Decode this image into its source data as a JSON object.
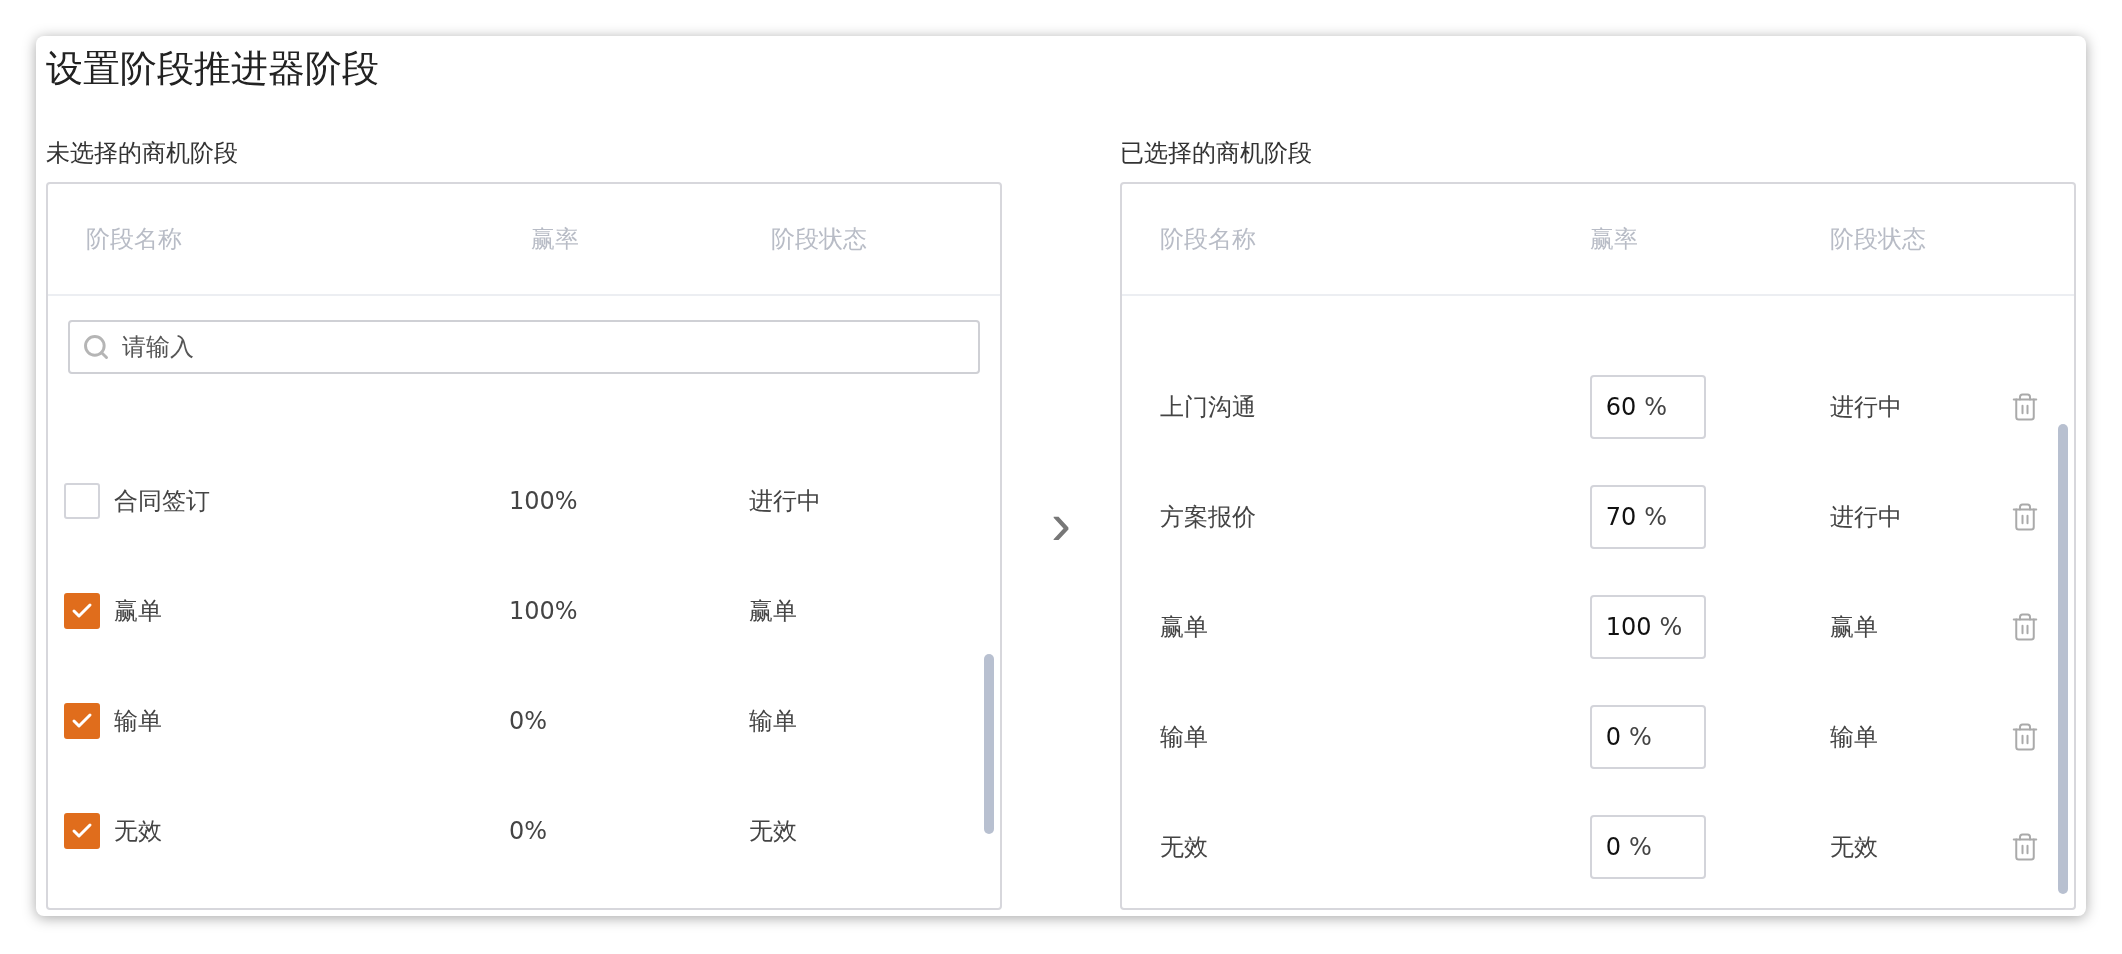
{
  "dialog": {
    "title": "设置阶段推进器阶段"
  },
  "unselected": {
    "title": "未选择的商机阶段",
    "columns": [
      "阶段名称",
      "赢率",
      "阶段状态"
    ],
    "search": {
      "placeholder": "请输入"
    },
    "rows": [
      {
        "name": "合同签订",
        "rate": "100%",
        "status": "进行中",
        "checked": false
      },
      {
        "name": "赢单",
        "rate": "100%",
        "status": "赢单",
        "checked": true
      },
      {
        "name": "输单",
        "rate": "0%",
        "status": "输单",
        "checked": true
      },
      {
        "name": "无效",
        "rate": "0%",
        "status": "无效",
        "checked": true
      }
    ]
  },
  "move_button": {
    "label": "›"
  },
  "selected": {
    "title": "已选择的商机阶段",
    "columns": [
      "阶段名称",
      "赢率",
      "阶段状态"
    ],
    "rows": [
      {
        "name": "上门沟通",
        "rate": "60",
        "unit": "%",
        "status": "进行中"
      },
      {
        "name": "方案报价",
        "rate": "70",
        "unit": "%",
        "status": "进行中"
      },
      {
        "name": "赢单",
        "rate": "100",
        "unit": "%",
        "status": "赢单"
      },
      {
        "name": "输单",
        "rate": "0",
        "unit": "%",
        "status": "输单"
      },
      {
        "name": "无效",
        "rate": "0",
        "unit": "%",
        "status": "无效"
      }
    ]
  }
}
